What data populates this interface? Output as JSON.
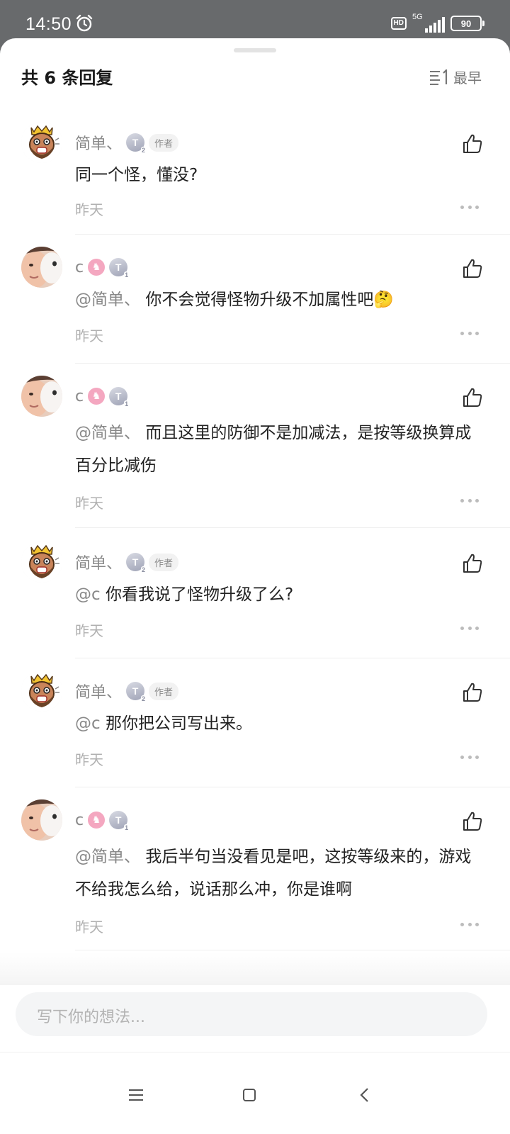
{
  "status_bar": {
    "time": "14:50",
    "hd": "HD",
    "network": "5G",
    "battery": "90"
  },
  "sheet": {
    "title": "共 6 条回复",
    "sort_label": "最早"
  },
  "comments": [
    {
      "user": "简单、",
      "level": "T",
      "level_num": "2",
      "tag": "作者",
      "mention": "",
      "text": "同一个怪，懂没?",
      "time": "昨天"
    },
    {
      "user": "c",
      "level": "T",
      "level_num": "1",
      "tag": "",
      "mention": "@简单、",
      "text": "你不会觉得怪物升级不加属性吧🤔",
      "time": "昨天"
    },
    {
      "user": "c",
      "level": "T",
      "level_num": "1",
      "tag": "",
      "mention": "@简单、",
      "text": "而且这里的防御不是加减法，是按等级换算成百分比减伤",
      "time": "昨天"
    },
    {
      "user": "简单、",
      "level": "T",
      "level_num": "2",
      "tag": "作者",
      "mention": "@c",
      "text": "你看我说了怪物升级了么?",
      "time": "昨天"
    },
    {
      "user": "简单、",
      "level": "T",
      "level_num": "2",
      "tag": "作者",
      "mention": "@c",
      "text": "那你把公司写出来。",
      "time": "昨天"
    },
    {
      "user": "c",
      "level": "T",
      "level_num": "1",
      "tag": "",
      "mention": "@简单、",
      "text": "我后半句当没看见是吧，这按等级来的，游戏不给我怎么给，说话那么冲，你是谁啊",
      "time": "昨天"
    }
  ],
  "input": {
    "placeholder": "写下你的想法..."
  },
  "colors": {
    "text_primary": "#222222",
    "text_secondary": "#888888",
    "time_gray": "#b0b0b0",
    "status_bg": "#686a6c"
  }
}
